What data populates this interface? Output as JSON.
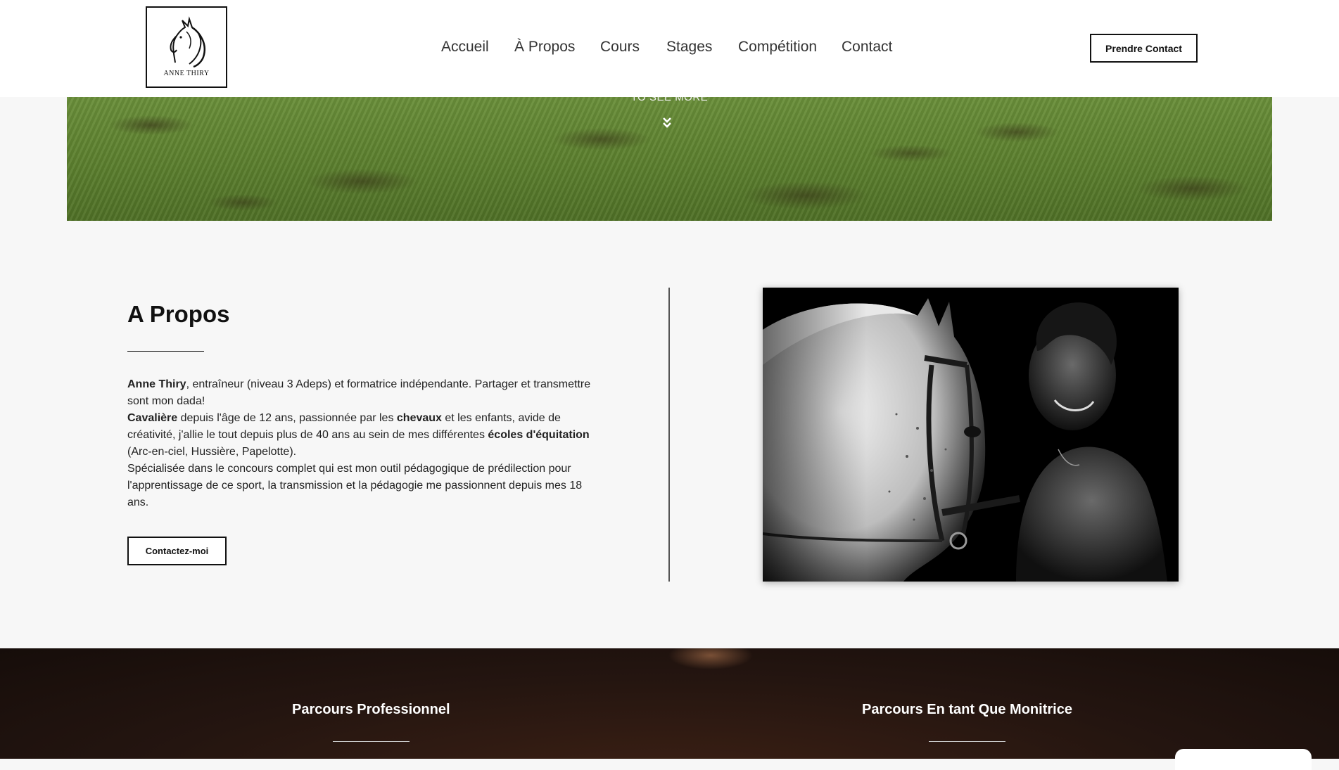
{
  "header": {
    "logo_text": "ANNE THIRY",
    "nav": [
      "Accueil",
      "À Propos",
      "Cours",
      "Stages",
      "Compétition",
      "Contact"
    ],
    "cta_label": "Prendre Contact"
  },
  "hero": {
    "see_more": "TO SEE MORE",
    "chevron_icon": "double-chevron-down-icon"
  },
  "about": {
    "title": "A Propos",
    "name": "Anne Thiry",
    "line1_rest": ", entraîneur (niveau 3 Adeps) et formatrice indépendante. Partager et transmettre sont mon dada!",
    "cavaliere": "Cavalière",
    "line2_a": " depuis l'âge de 12 ans, passionnée par les ",
    "chevaux": "chevaux",
    "line2_b": " et les enfants, avide de créativité, j'allie le tout depuis plus de 40 ans au sein de mes différentes ",
    "ecoles": "écoles d'équitation",
    "line2_c": " (Arc-en-ciel, Hussière, Papelotte).",
    "line3": "Spécialisée dans le concours complet qui est mon outil pédagogique de prédilection pour l'apprentissage de ce sport, la transmission et la pédagogie me passionnent depuis mes 18 ans.",
    "button": "Contactez-moi"
  },
  "bottom": {
    "left_title": "Parcours Professionnel",
    "right_title": "Parcours En tant Que Monitrice"
  },
  "colors": {
    "accent": "#111111",
    "grass": "#5e8230",
    "footer_bg": "#241510"
  }
}
